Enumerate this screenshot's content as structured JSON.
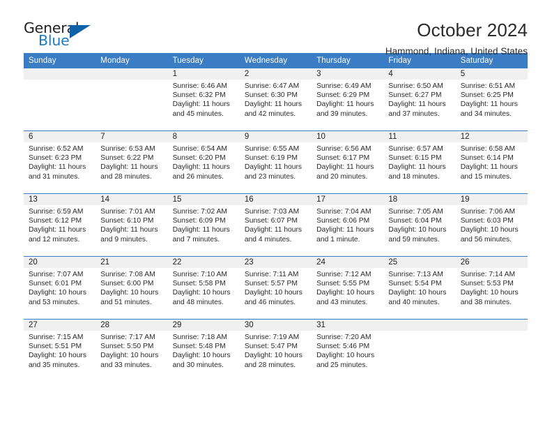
{
  "brand": {
    "name_top": "General",
    "name_bottom": "Blue",
    "color_dark": "#231f20",
    "color_blue": "#1a7bc4",
    "triangle_color": "#1062a8"
  },
  "header": {
    "title": "October 2024",
    "subtitle": "Hammond, Indiana, United States"
  },
  "theme": {
    "header_bg": "#3b7dc4",
    "header_text": "#ffffff",
    "daynum_bg": "#f0f0f0",
    "rule_color": "#3b7dc4"
  },
  "weekdays": [
    "Sunday",
    "Monday",
    "Tuesday",
    "Wednesday",
    "Thursday",
    "Friday",
    "Saturday"
  ],
  "weeks": [
    [
      {
        "day": "",
        "info": ""
      },
      {
        "day": "",
        "info": ""
      },
      {
        "day": "1",
        "info": "Sunrise: 6:46 AM\nSunset: 6:32 PM\nDaylight: 11 hours\nand 45 minutes."
      },
      {
        "day": "2",
        "info": "Sunrise: 6:47 AM\nSunset: 6:30 PM\nDaylight: 11 hours\nand 42 minutes."
      },
      {
        "day": "3",
        "info": "Sunrise: 6:49 AM\nSunset: 6:29 PM\nDaylight: 11 hours\nand 39 minutes."
      },
      {
        "day": "4",
        "info": "Sunrise: 6:50 AM\nSunset: 6:27 PM\nDaylight: 11 hours\nand 37 minutes."
      },
      {
        "day": "5",
        "info": "Sunrise: 6:51 AM\nSunset: 6:25 PM\nDaylight: 11 hours\nand 34 minutes."
      }
    ],
    [
      {
        "day": "6",
        "info": "Sunrise: 6:52 AM\nSunset: 6:23 PM\nDaylight: 11 hours\nand 31 minutes."
      },
      {
        "day": "7",
        "info": "Sunrise: 6:53 AM\nSunset: 6:22 PM\nDaylight: 11 hours\nand 28 minutes."
      },
      {
        "day": "8",
        "info": "Sunrise: 6:54 AM\nSunset: 6:20 PM\nDaylight: 11 hours\nand 26 minutes."
      },
      {
        "day": "9",
        "info": "Sunrise: 6:55 AM\nSunset: 6:19 PM\nDaylight: 11 hours\nand 23 minutes."
      },
      {
        "day": "10",
        "info": "Sunrise: 6:56 AM\nSunset: 6:17 PM\nDaylight: 11 hours\nand 20 minutes."
      },
      {
        "day": "11",
        "info": "Sunrise: 6:57 AM\nSunset: 6:15 PM\nDaylight: 11 hours\nand 18 minutes."
      },
      {
        "day": "12",
        "info": "Sunrise: 6:58 AM\nSunset: 6:14 PM\nDaylight: 11 hours\nand 15 minutes."
      }
    ],
    [
      {
        "day": "13",
        "info": "Sunrise: 6:59 AM\nSunset: 6:12 PM\nDaylight: 11 hours\nand 12 minutes."
      },
      {
        "day": "14",
        "info": "Sunrise: 7:01 AM\nSunset: 6:10 PM\nDaylight: 11 hours\nand 9 minutes."
      },
      {
        "day": "15",
        "info": "Sunrise: 7:02 AM\nSunset: 6:09 PM\nDaylight: 11 hours\nand 7 minutes."
      },
      {
        "day": "16",
        "info": "Sunrise: 7:03 AM\nSunset: 6:07 PM\nDaylight: 11 hours\nand 4 minutes."
      },
      {
        "day": "17",
        "info": "Sunrise: 7:04 AM\nSunset: 6:06 PM\nDaylight: 11 hours\nand 1 minute."
      },
      {
        "day": "18",
        "info": "Sunrise: 7:05 AM\nSunset: 6:04 PM\nDaylight: 10 hours\nand 59 minutes."
      },
      {
        "day": "19",
        "info": "Sunrise: 7:06 AM\nSunset: 6:03 PM\nDaylight: 10 hours\nand 56 minutes."
      }
    ],
    [
      {
        "day": "20",
        "info": "Sunrise: 7:07 AM\nSunset: 6:01 PM\nDaylight: 10 hours\nand 53 minutes."
      },
      {
        "day": "21",
        "info": "Sunrise: 7:08 AM\nSunset: 6:00 PM\nDaylight: 10 hours\nand 51 minutes."
      },
      {
        "day": "22",
        "info": "Sunrise: 7:10 AM\nSunset: 5:58 PM\nDaylight: 10 hours\nand 48 minutes."
      },
      {
        "day": "23",
        "info": "Sunrise: 7:11 AM\nSunset: 5:57 PM\nDaylight: 10 hours\nand 46 minutes."
      },
      {
        "day": "24",
        "info": "Sunrise: 7:12 AM\nSunset: 5:55 PM\nDaylight: 10 hours\nand 43 minutes."
      },
      {
        "day": "25",
        "info": "Sunrise: 7:13 AM\nSunset: 5:54 PM\nDaylight: 10 hours\nand 40 minutes."
      },
      {
        "day": "26",
        "info": "Sunrise: 7:14 AM\nSunset: 5:53 PM\nDaylight: 10 hours\nand 38 minutes."
      }
    ],
    [
      {
        "day": "27",
        "info": "Sunrise: 7:15 AM\nSunset: 5:51 PM\nDaylight: 10 hours\nand 35 minutes."
      },
      {
        "day": "28",
        "info": "Sunrise: 7:17 AM\nSunset: 5:50 PM\nDaylight: 10 hours\nand 33 minutes."
      },
      {
        "day": "29",
        "info": "Sunrise: 7:18 AM\nSunset: 5:48 PM\nDaylight: 10 hours\nand 30 minutes."
      },
      {
        "day": "30",
        "info": "Sunrise: 7:19 AM\nSunset: 5:47 PM\nDaylight: 10 hours\nand 28 minutes."
      },
      {
        "day": "31",
        "info": "Sunrise: 7:20 AM\nSunset: 5:46 PM\nDaylight: 10 hours\nand 25 minutes."
      },
      {
        "day": "",
        "info": ""
      },
      {
        "day": "",
        "info": ""
      }
    ]
  ]
}
